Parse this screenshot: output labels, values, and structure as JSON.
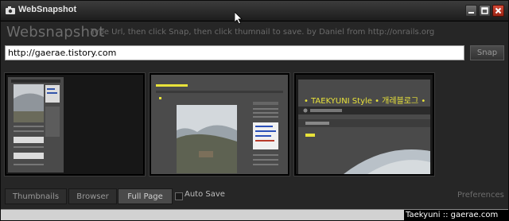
{
  "window": {
    "title": "WebSnapshot"
  },
  "header": {
    "app_name": "Websnapshot",
    "instructions": "Type Url, then click Snap, then click thumnail to save. by Daniel from http://onrails.org"
  },
  "url_bar": {
    "value": "http://gaerae.tistory.com",
    "snap_label": "Snap"
  },
  "thumbnails": [
    {
      "name": "thumbnail-1"
    },
    {
      "name": "thumbnail-2"
    },
    {
      "name": "thumbnail-3",
      "blog_title": "• TAEKYUNI Style • 개레블로그 •"
    }
  ],
  "tabs": [
    {
      "label": "Thumbnails",
      "active": false
    },
    {
      "label": "Browser",
      "active": false
    },
    {
      "label": "Full Page",
      "active": true
    }
  ],
  "auto_save": {
    "label": "Auto Save",
    "checked": false
  },
  "preferences": {
    "label": "Preferences"
  },
  "watermark": {
    "text": "Taekyuni :: gaerae.com"
  },
  "colors": {
    "background": "#262626",
    "accent_yellow": "#e8e23a",
    "close_red": "#c43a28"
  },
  "icons": {
    "app": "camera-icon",
    "minimize": "minimize-icon",
    "maximize": "maximize-icon",
    "close": "close-icon",
    "cursor": "mouse-cursor-icon"
  }
}
